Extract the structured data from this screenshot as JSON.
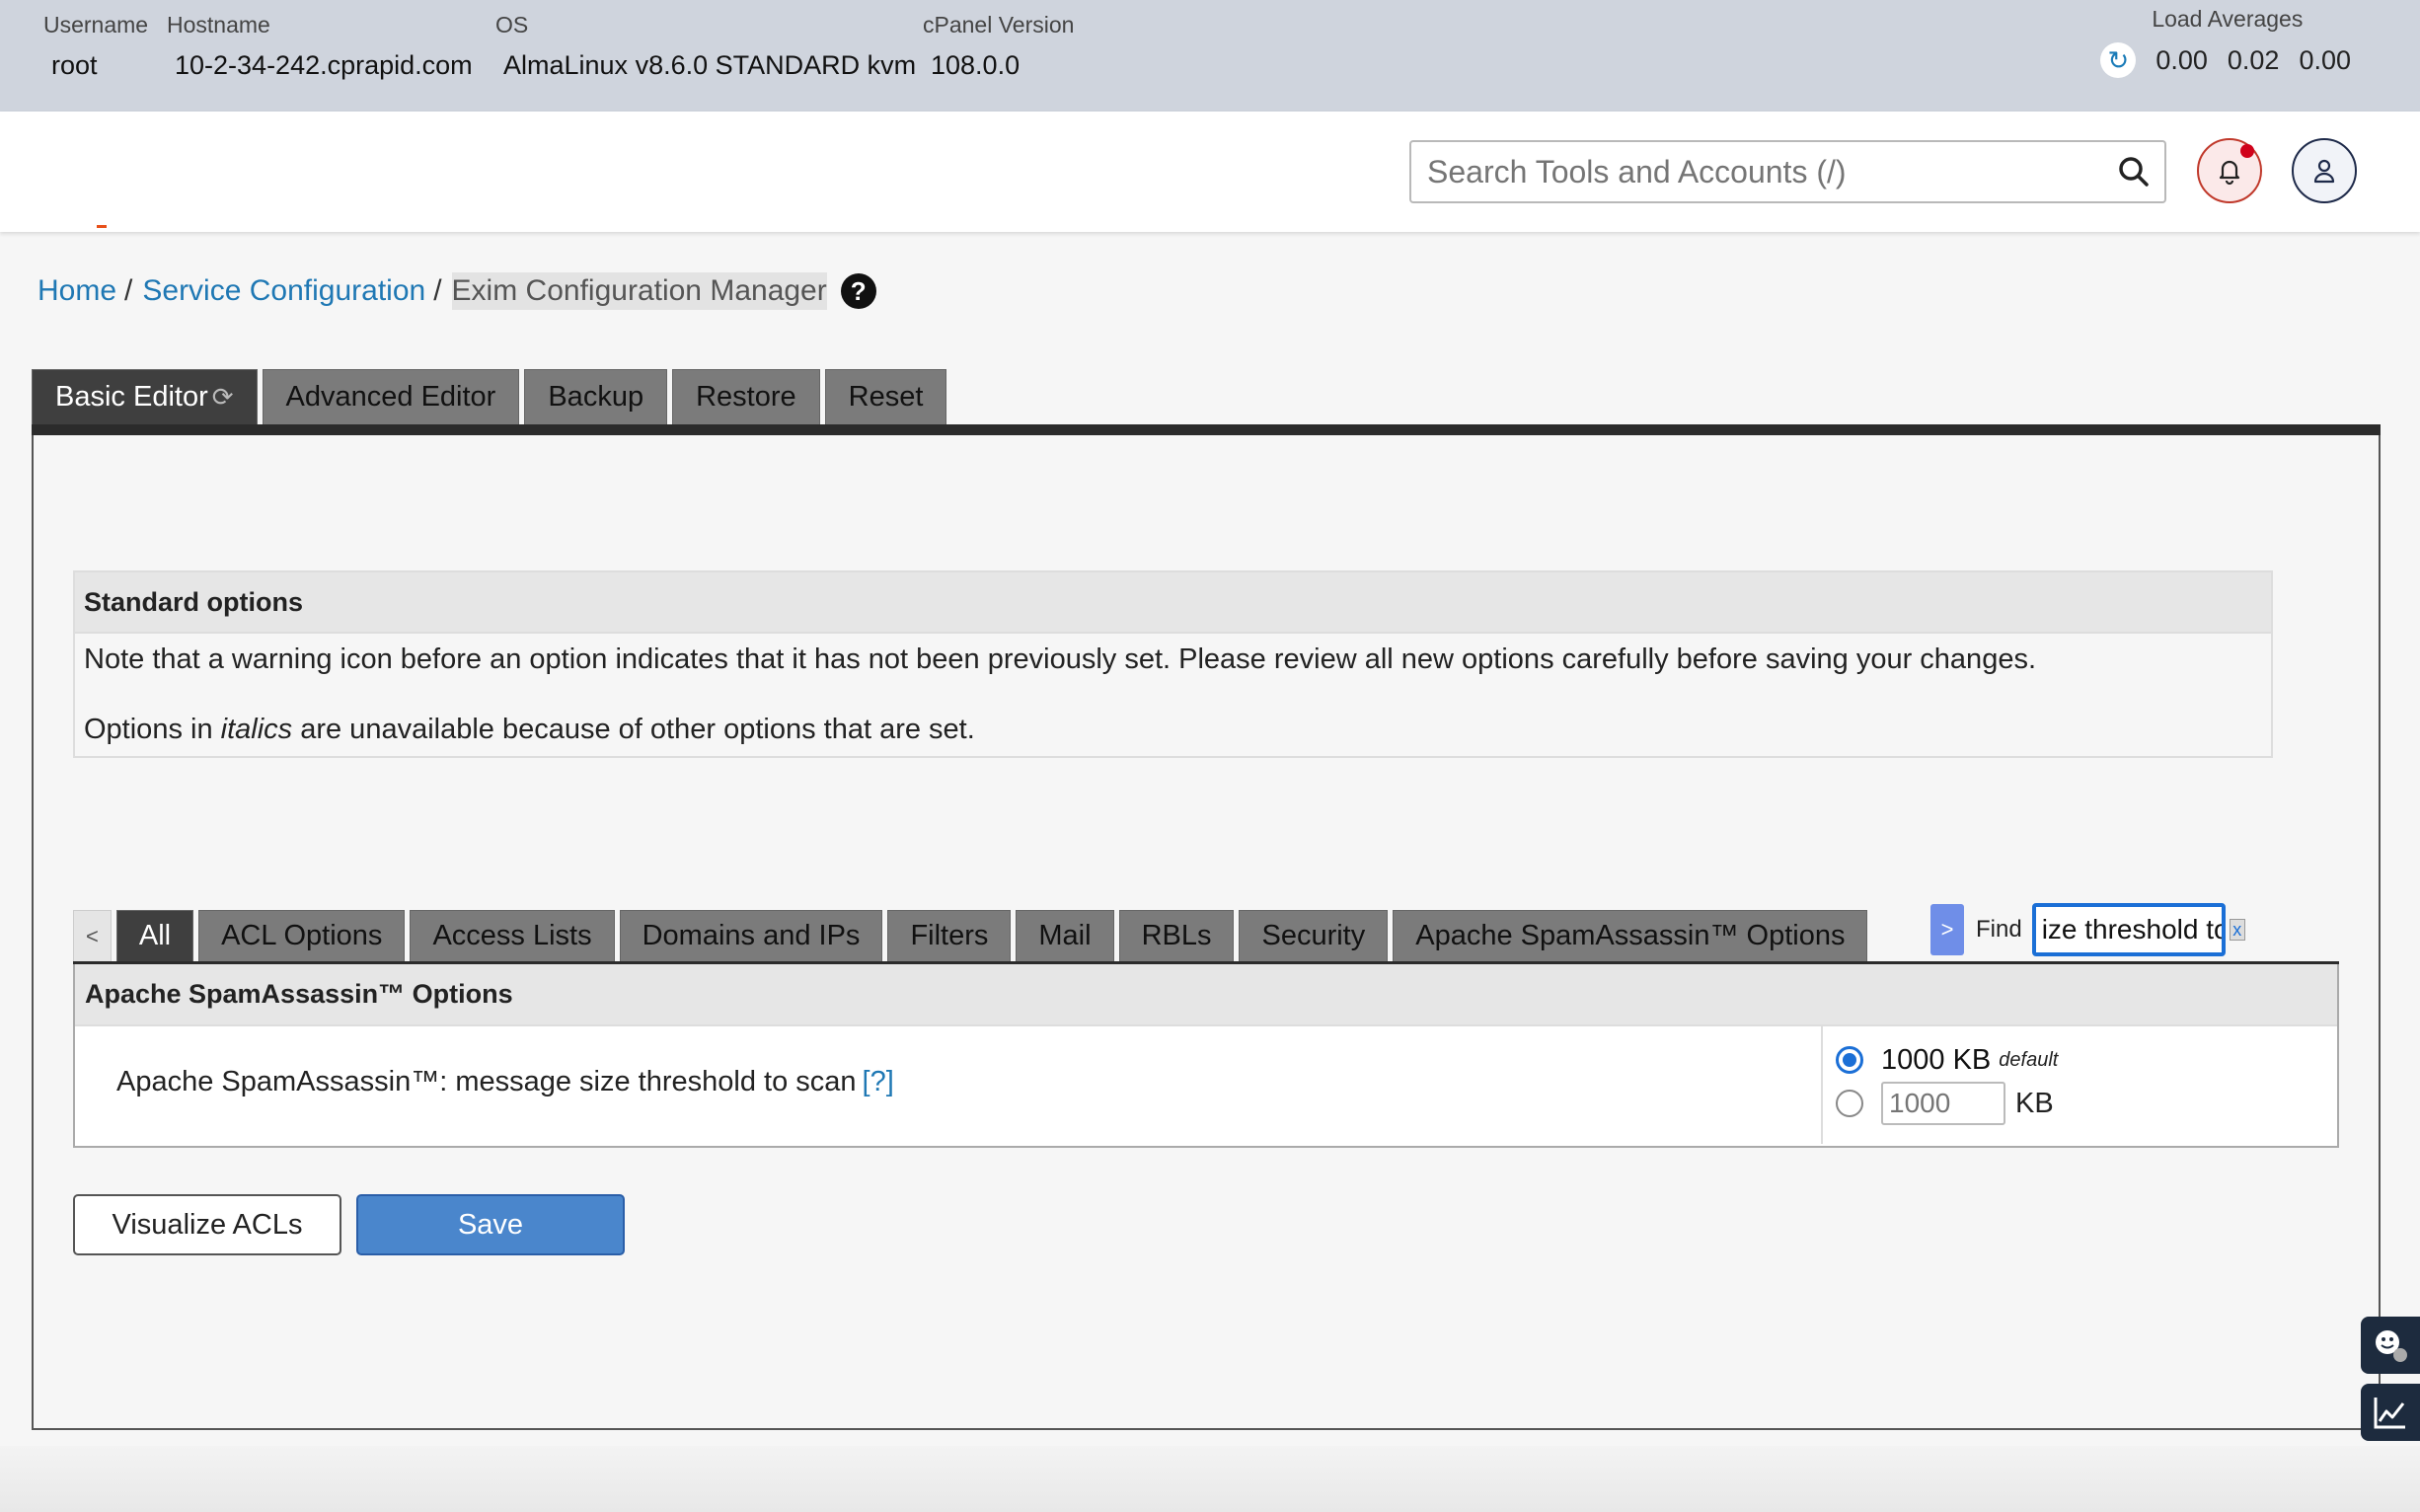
{
  "server_info": {
    "username_label": "Username",
    "username": "root",
    "hostname_label": "Hostname",
    "hostname": "10-2-34-242.cprapid.com",
    "os_label": "OS",
    "os": "AlmaLinux v8.6.0 STANDARD kvm",
    "cpanel_version_label": "cPanel Version",
    "cpanel_version": "108.0.0",
    "load_averages_label": "Load Averages",
    "load_averages": [
      "0.00",
      "0.02",
      "0.00"
    ]
  },
  "header": {
    "search_placeholder": "Search Tools and Accounts (/)",
    "notification_badge": true
  },
  "breadcrumb": {
    "home": "Home",
    "sep1": "/",
    "section": "Service Configuration",
    "sep2": "/",
    "current": "Exim Configuration Manager",
    "help": "?"
  },
  "main_tabs": [
    {
      "label": "Basic Editor",
      "active": true
    },
    {
      "label": "Advanced Editor",
      "active": false
    },
    {
      "label": "Backup",
      "active": false
    },
    {
      "label": "Restore",
      "active": false
    },
    {
      "label": "Reset",
      "active": false
    }
  ],
  "standard_options": {
    "heading": "Standard options",
    "note": "Note that a warning icon before an option indicates that it has not been previously set. Please review all new options carefully before saving your changes.",
    "italics_prefix": "Options in ",
    "italics_word": "italics",
    "italics_suffix": " are unavailable because of other options that are set."
  },
  "sub_tabs": {
    "prev": "<",
    "items": [
      {
        "label": "All",
        "active": true
      },
      {
        "label": "ACL Options",
        "active": false
      },
      {
        "label": "Access Lists",
        "active": false
      },
      {
        "label": "Domains and IPs",
        "active": false
      },
      {
        "label": "Filters",
        "active": false
      },
      {
        "label": "Mail",
        "active": false
      },
      {
        "label": "RBLs",
        "active": false
      },
      {
        "label": "Security",
        "active": false
      },
      {
        "label": "Apache SpamAssassin™ Options",
        "active": false
      }
    ],
    "next": ">",
    "find_label": "Find",
    "find_value": "ize threshold to scan",
    "find_clear": "x"
  },
  "option_section": {
    "heading": "Apache SpamAssassin™ Options",
    "option_label": "Apache SpamAssassin™: message size threshold to scan",
    "help_link": "[?]",
    "default_value": "1000 KB",
    "default_tag": "default",
    "custom_value": "1000",
    "unit": "KB",
    "selected": "default"
  },
  "buttons": {
    "visualize": "Visualize ACLs",
    "save": "Save"
  },
  "colors": {
    "infobar_bg": "#cfd4dd",
    "link": "#1f78b4",
    "save_button": "#4a86cc",
    "tab_active": "#3f3f3f",
    "tab_inactive": "#7b7b7b",
    "notification_dot": "#d0021b"
  }
}
